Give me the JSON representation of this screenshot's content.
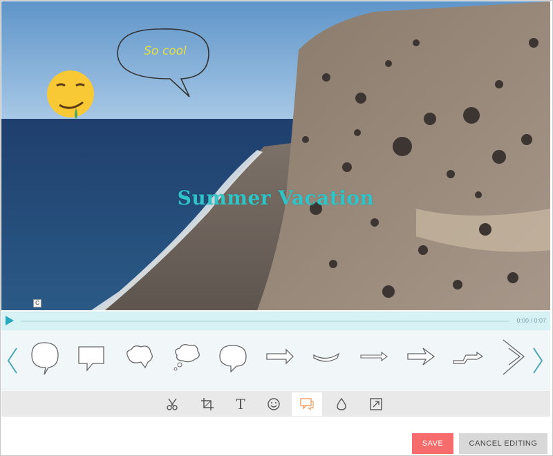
{
  "video": {
    "overlay_title": "Summer Vacation",
    "bubble_text": "So cool",
    "marker": "C"
  },
  "timeline": {
    "time": "0:00 / 0:07",
    "play_icon": "play-icon"
  },
  "shapes": [
    "speech-bubble-round",
    "speech-bubble-rect",
    "speech-bubble-cloud",
    "thought-bubble",
    "speech-bubble-oval",
    "arrow-block",
    "arrow-curved",
    "arrow-thin",
    "arrow-outline",
    "arrow-zigzag",
    "arrow-chevrons"
  ],
  "tools": [
    {
      "name": "scissors-icon",
      "active": false
    },
    {
      "name": "crop-icon",
      "active": false
    },
    {
      "name": "text-icon",
      "label": "T",
      "active": false
    },
    {
      "name": "emoji-icon",
      "active": false
    },
    {
      "name": "speech-bubble-icon",
      "active": true
    },
    {
      "name": "drop-icon",
      "active": false
    },
    {
      "name": "resize-icon",
      "active": false
    }
  ],
  "buttons": {
    "save": "SAVE",
    "cancel": "CANCEL EDITING"
  },
  "colors": {
    "accent": "#2aa8c0",
    "save": "#f66b6b",
    "overlay_title": "#2ec4c8",
    "bubble_text": "#e6e13a",
    "active_tool": "#f0a060"
  }
}
